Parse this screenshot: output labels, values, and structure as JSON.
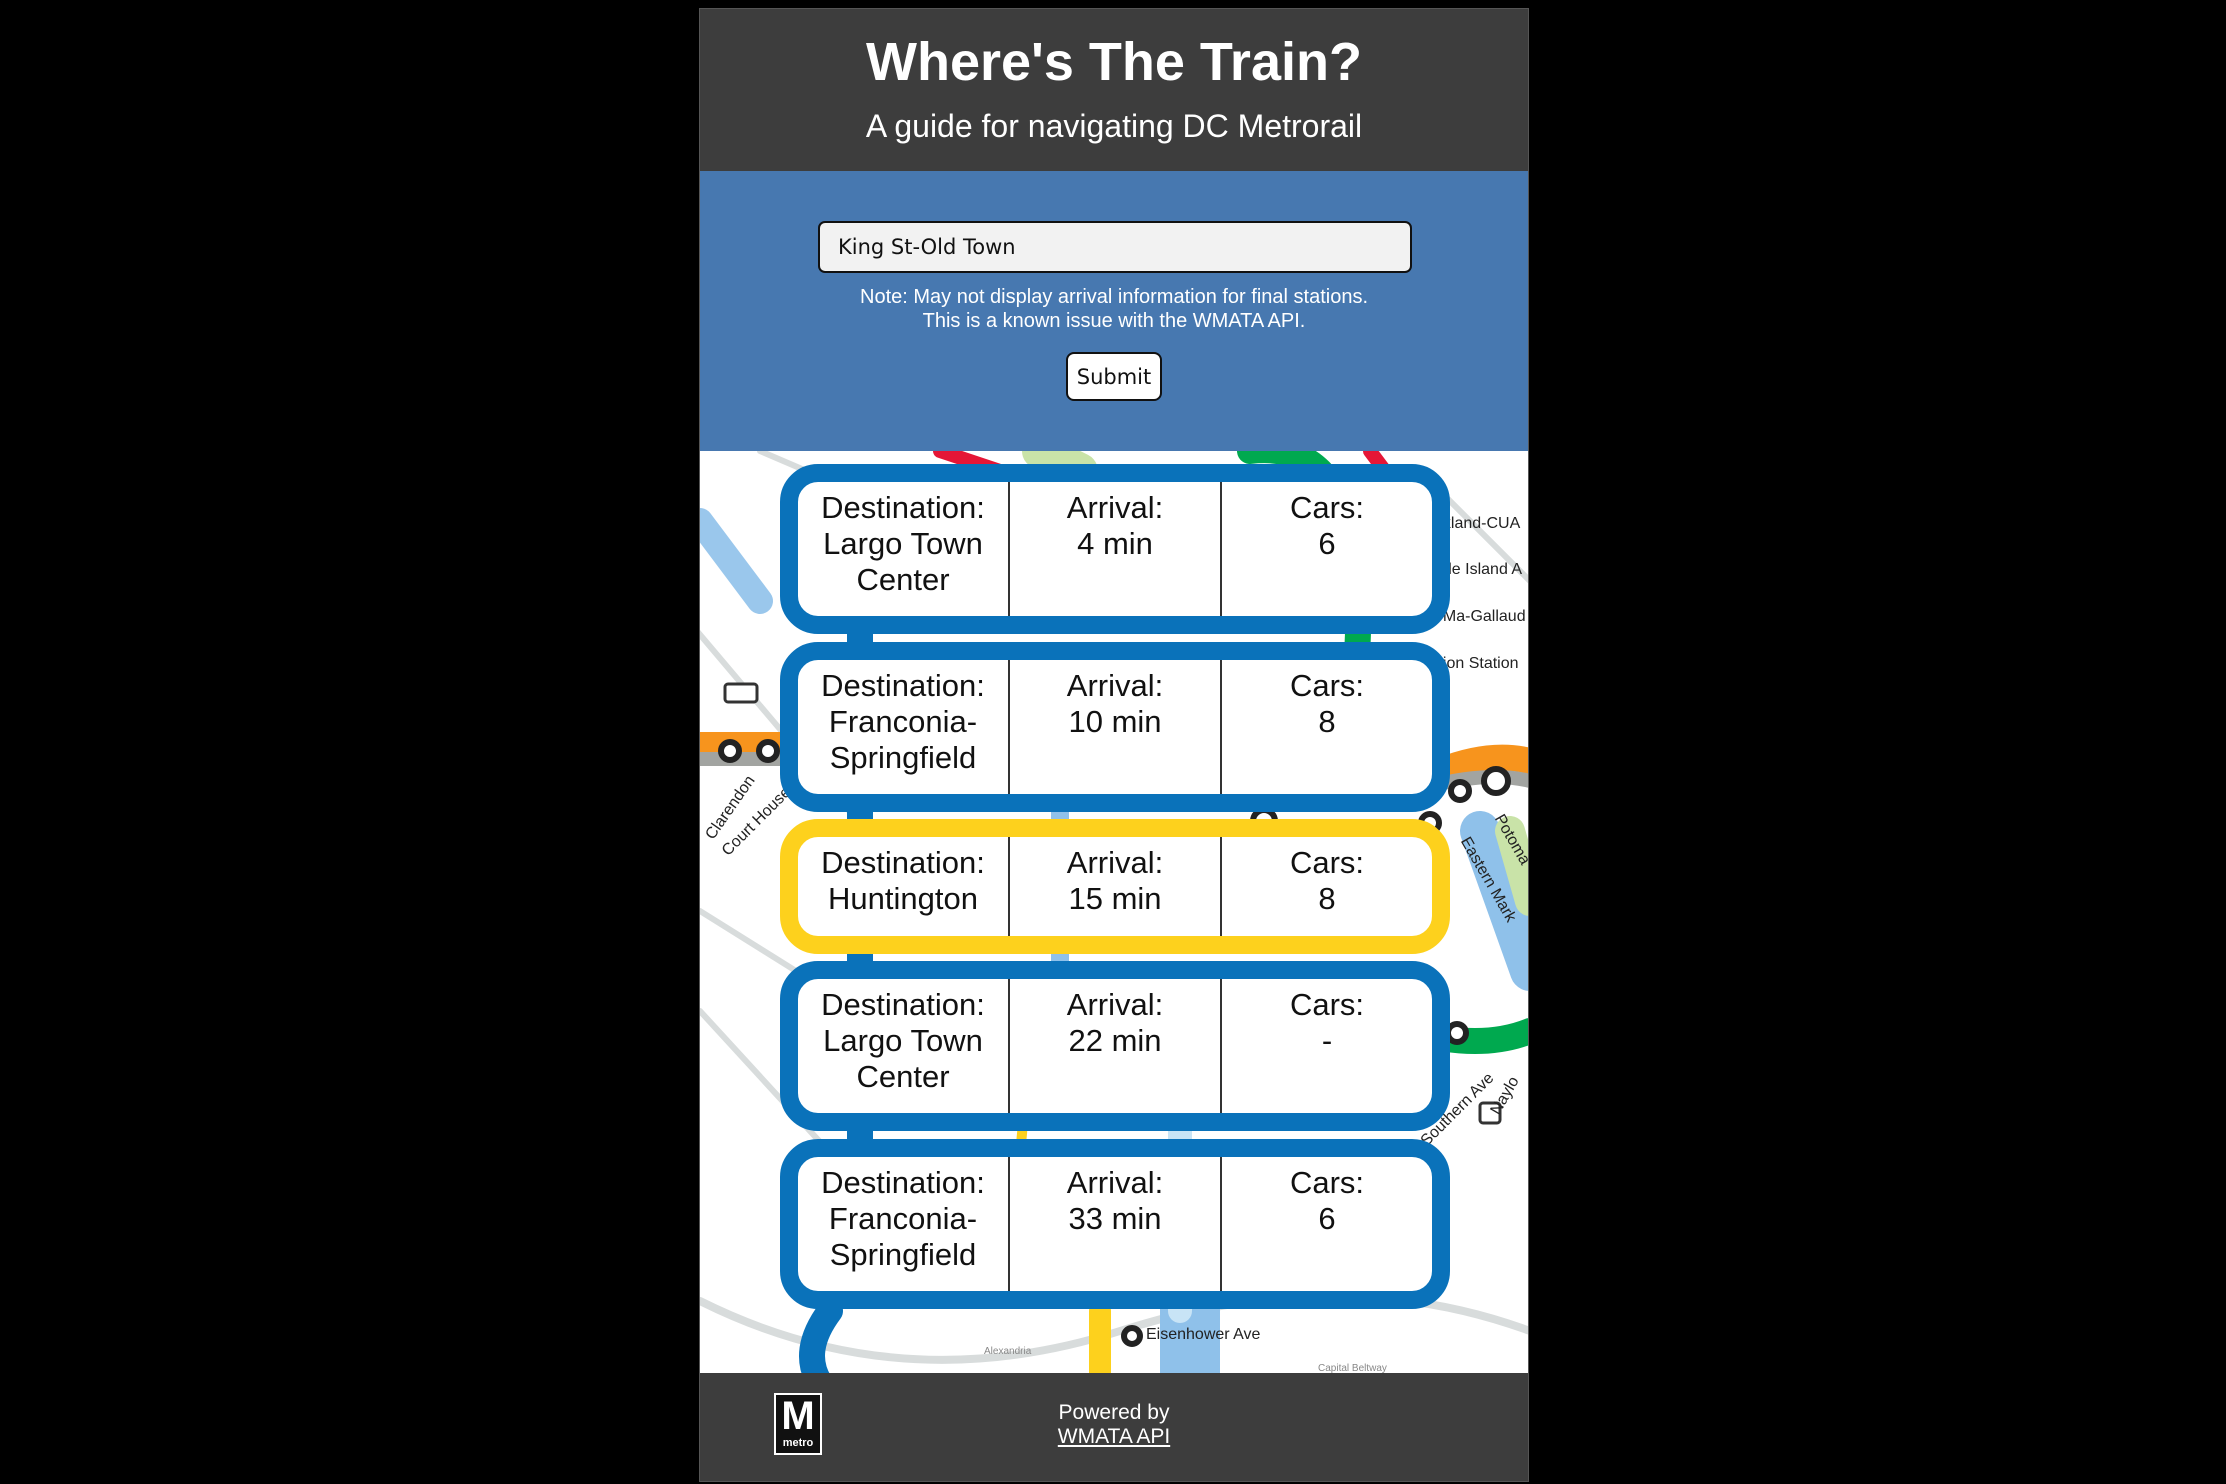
{
  "header": {
    "title": "Where's The Train?",
    "subtitle": "A guide for navigating DC Metrorail"
  },
  "search": {
    "station_value": "King St-Old Town",
    "note_line1": "Note: May not display arrival information for final stations.",
    "note_line2": "This is a known issue with the WMATA API.",
    "submit_label": "Submit"
  },
  "arrivals": [
    {
      "destination_label": "Destination:",
      "destination": "Largo Town Center",
      "arrival_label": "Arrival:",
      "arrival": "4 min",
      "cars_label": "Cars:",
      "cars": "6",
      "line_color": "#0a72ba"
    },
    {
      "destination_label": "Destination:",
      "destination": "Franconia-Springfield",
      "arrival_label": "Arrival:",
      "arrival": "10 min",
      "cars_label": "Cars:",
      "cars": "8",
      "line_color": "#0a72ba"
    },
    {
      "destination_label": "Destination:",
      "destination": "Huntington",
      "arrival_label": "Arrival:",
      "arrival": "15 min",
      "cars_label": "Cars:",
      "cars": "8",
      "line_color": "#fdd11d"
    },
    {
      "destination_label": "Destination:",
      "destination": "Largo Town Center",
      "arrival_label": "Arrival:",
      "arrival": "22 min",
      "cars_label": "Cars:",
      "cars": "-",
      "line_color": "#0a72ba"
    },
    {
      "destination_label": "Destination:",
      "destination": "Franconia-Springfield",
      "arrival_label": "Arrival:",
      "arrival": "33 min",
      "cars_label": "Cars:",
      "cars": "6",
      "line_color": "#0a72ba"
    }
  ],
  "map_labels": {
    "rockland": "okland-CUA",
    "rhode_island": "ode Island A",
    "noma": "oMa-Gallaud",
    "union_station": "nion Station",
    "clarendon": "Clarendon",
    "court_house": "Court House",
    "eastern_market": "Eastern Mark",
    "potomac": "Potoma",
    "southern_ave": "Southern Ave",
    "naylor": "Naylo",
    "eisenhower": "Eisenhower Ave",
    "alexandria": "Alexandria",
    "capital_beltway": "Capital Beltway"
  },
  "footer": {
    "logo_letter": "M",
    "logo_word": "metro",
    "powered_by": "Powered by",
    "api_link": "WMATA API"
  }
}
